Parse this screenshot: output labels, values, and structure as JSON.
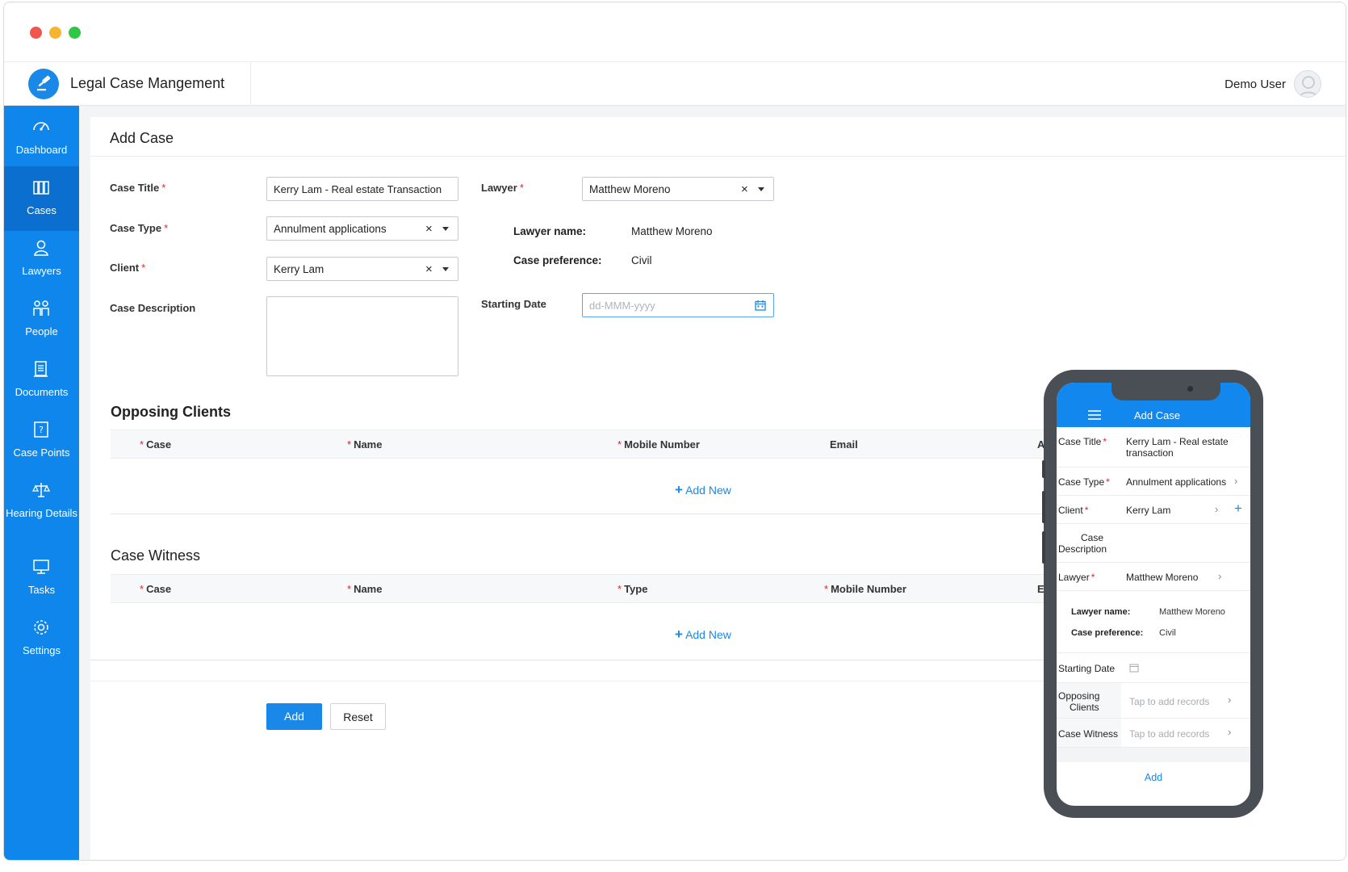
{
  "app": {
    "title": "Legal Case Mangement",
    "user": "Demo User",
    "brand_color": "#0f86eb"
  },
  "sidebar": {
    "items": [
      {
        "label": "Dashboard",
        "icon": "dashboard-icon"
      },
      {
        "label": "Cases",
        "icon": "books-icon",
        "active": true
      },
      {
        "label": "Lawyers",
        "icon": "person-icon"
      },
      {
        "label": "People",
        "icon": "people-icon"
      },
      {
        "label": "Documents",
        "icon": "document-icon"
      },
      {
        "label": "Case Points",
        "icon": "question-icon"
      },
      {
        "label": "Hearing Details",
        "icon": "scales-icon"
      },
      {
        "label": "Tasks",
        "icon": "monitor-icon"
      },
      {
        "label": "Settings",
        "icon": "gear-icon"
      }
    ]
  },
  "form": {
    "title": "Add Case",
    "case_title_label": "Case Title",
    "case_title_value": "Kerry Lam - Real estate Transaction",
    "case_type_label": "Case Type",
    "case_type_value": "Annulment applications",
    "client_label": "Client",
    "client_value": "Kerry Lam",
    "description_label": "Case Description",
    "lawyer_label": "Lawyer",
    "lawyer_value": "Matthew Moreno",
    "lawyer_name_key": "Lawyer name:",
    "lawyer_name_value": "Matthew Moreno",
    "case_pref_key": "Case preference:",
    "case_pref_value": "Civil",
    "starting_date_label": "Starting Date",
    "starting_date_placeholder": "dd-MMM-yyyy",
    "required_mark": "*"
  },
  "opposing": {
    "title": "Opposing Clients",
    "columns": [
      "Case",
      "Name",
      "Mobile Number",
      "Email",
      "Ac"
    ],
    "add_new": "Add New"
  },
  "witness": {
    "title": "Case Witness",
    "columns": [
      "Case",
      "Name",
      "Type",
      "Mobile Number",
      "Em"
    ],
    "add_new": "Add New"
  },
  "buttons": {
    "add": "Add",
    "reset": "Reset"
  },
  "phone": {
    "header_title": "Add Case",
    "case_title_label": "Case Title",
    "case_title_value": "Kerry Lam - Real estate transaction",
    "case_type_label": "Case Type",
    "case_type_value": "Annulment applications",
    "client_label": "Client",
    "client_value": "Kerry Lam",
    "description_label_1": "Case",
    "description_label_2": "Description",
    "lawyer_label": "Lawyer",
    "lawyer_value": "Matthew Moreno",
    "lawyer_name_key": "Lawyer name:",
    "lawyer_name_value": "Matthew Moreno",
    "case_pref_key": "Case preference:",
    "case_pref_value": "Civil",
    "starting_date_label": "Starting Date",
    "opposing_label_1": "Opposing",
    "opposing_label_2": "Clients",
    "opposing_placeholder": "Tap to add records",
    "witness_label": "Case Witness",
    "witness_placeholder": "Tap to add records",
    "add_button": "Add"
  }
}
